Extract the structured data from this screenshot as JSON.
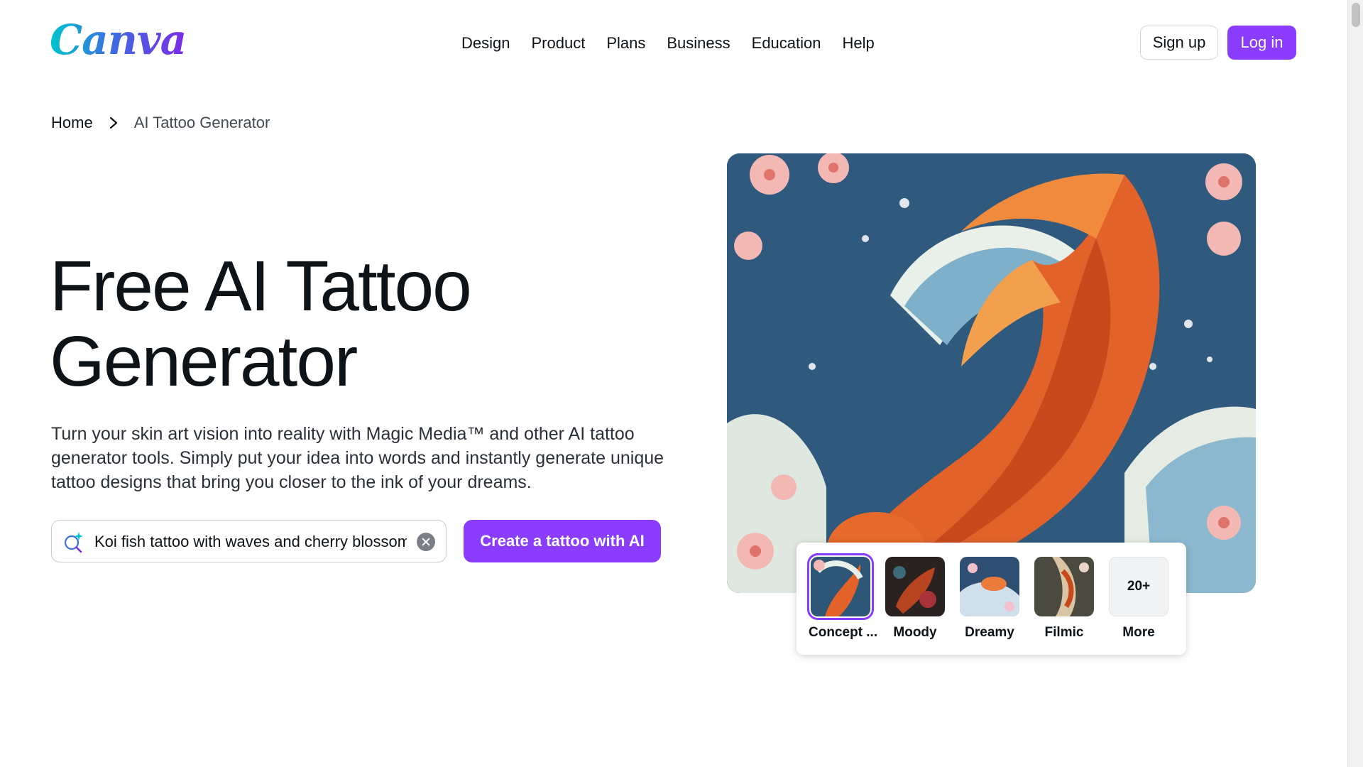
{
  "header": {
    "logo": "Canva",
    "nav": [
      "Design",
      "Product",
      "Plans",
      "Business",
      "Education",
      "Help"
    ],
    "signup_label": "Sign up",
    "login_label": "Log in"
  },
  "breadcrumb": {
    "home": "Home",
    "current": "AI Tattoo Generator"
  },
  "hero": {
    "title_line1": "Free AI Tattoo",
    "title_line2": "Generator",
    "description": "Turn your skin art vision into reality with Magic Media™ and other AI tattoo generator tools. Simply put your idea into words and instantly generate unique tattoo designs that bring you closer to the ink of your dreams.",
    "search_value": "Koi fish tattoo with waves and cherry blossoms",
    "create_button": "Create a tattoo with AI"
  },
  "styles": {
    "options": [
      "Concept ...",
      "Moody",
      "Dreamy",
      "Filmic"
    ],
    "selected": "Concept ...",
    "more_count": "20+",
    "more_label": "More"
  },
  "colors": {
    "brand_purple": "#8b3dff",
    "text": "#0e1318"
  },
  "icons": [
    "chevron-right-icon",
    "magic-search-icon",
    "clear-icon"
  ]
}
